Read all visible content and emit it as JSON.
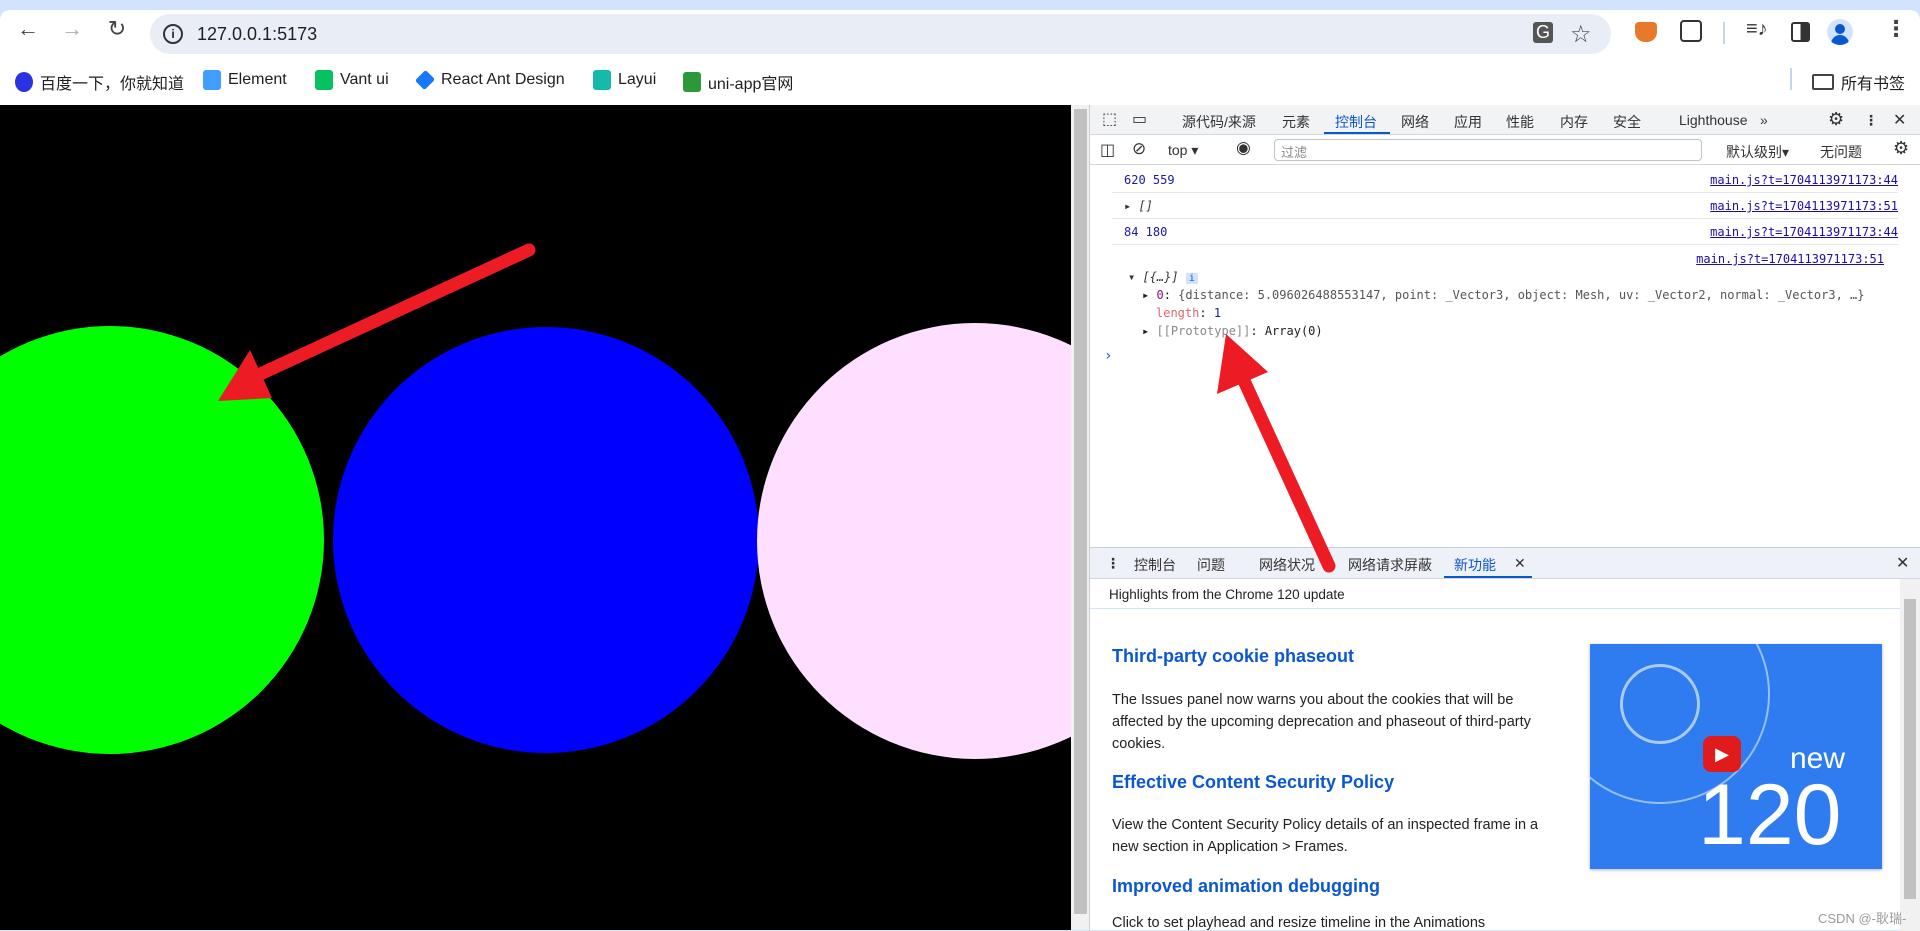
{
  "browser": {
    "url": "127.0.0.1:5173",
    "bookmarks": [
      {
        "label": "百度一下，你就知道",
        "color": "#2932e1"
      },
      {
        "label": "Element",
        "color": "#409eff"
      },
      {
        "label": "Vant ui",
        "color": "#07c160"
      },
      {
        "label": "React Ant Design",
        "color": "#1677ff"
      },
      {
        "label": "Layui",
        "color": "#16baaa"
      },
      {
        "label": "uni-app官网",
        "color": "#2b9939"
      }
    ],
    "all_bookmarks": "所有书签"
  },
  "page": {
    "circles": [
      {
        "color": "#00ff00"
      },
      {
        "color": "#0000ff"
      },
      {
        "color": "#ffdfff"
      }
    ],
    "arrow_color": "#ed1c24"
  },
  "devtools": {
    "tabs": [
      "源代码/来源",
      "元素",
      "控制台",
      "网络",
      "应用",
      "性能",
      "内存",
      "安全",
      "Lighthouse"
    ],
    "selected_tab": "控制台",
    "console_toolbar": {
      "context": "top",
      "filter_placeholder": "过滤",
      "level": "默认级别",
      "issues": "无问题"
    },
    "messages": [
      {
        "text": "620 559",
        "source": "main.js?t=1704113971173:44"
      },
      {
        "text": "[]",
        "source": "main.js?t=1704113971173:51"
      },
      {
        "text": "84 180",
        "source": "main.js?t=1704113971173:44"
      },
      {
        "text": "",
        "source": "main.js?t=1704113971173:51"
      }
    ],
    "tree": {
      "root": "[{…}]",
      "item0_key": "0",
      "item0_value": "{distance: 5.096026488553147, point: _Vector3, object: Mesh, uv: _Vector2, normal: _Vector3, …}",
      "length_key": "length",
      "length_value": "1",
      "proto_key": "[[Prototype]]",
      "proto_value": "Array(0)"
    },
    "drawer": {
      "tabs": [
        "控制台",
        "问题",
        "网络状况",
        "网络请求屏蔽",
        "新功能"
      ],
      "selected": "新功能",
      "header": "Highlights from the Chrome 120 update",
      "sections": [
        {
          "title": "Third-party cookie phaseout",
          "body": "The Issues panel now warns you about the cookies that will be affected by the upcoming deprecation and phaseout of third-party cookies."
        },
        {
          "title": "Effective Content Security Policy",
          "body": "View the Content Security Policy details of an inspected frame in a new section in Application > Frames."
        },
        {
          "title": "Improved animation debugging",
          "body": "Click to set playhead and resize timeline in the Animations"
        }
      ],
      "video": {
        "word": "new",
        "number": "120"
      }
    }
  },
  "watermark": "CSDN @-耿瑞-"
}
